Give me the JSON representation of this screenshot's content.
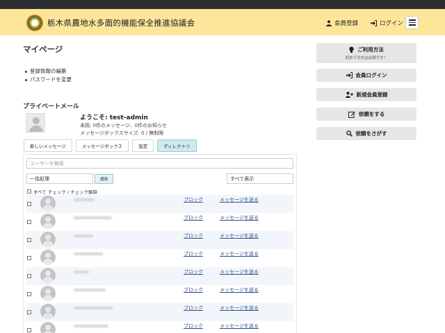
{
  "header": {
    "site_title": "栃木県農地水多面的機能保全推進協議会",
    "register": "会員登録",
    "login": "ログイン"
  },
  "page": {
    "title": "マイページ",
    "links": [
      "登録情報の編集",
      "パスワードを変更"
    ]
  },
  "pm": {
    "title": "プライベートメール",
    "welcome": "ようこそ: test-admin",
    "unread": "未読: 0件のメッセージ、0件のお知らせ",
    "box_size": "メッセージボックスサイズ: 0 / 無制限",
    "tabs": [
      "新しいメッセージ",
      "メッセージボックス",
      "設定",
      "ディレクトリ"
    ],
    "active_tab": "ディレクトリ",
    "search_placeholder": "ユーザーを検索",
    "bulk_action": "一括処理",
    "apply": "適用",
    "filter": "すべて表示",
    "check_all": "すべて チェック / チェック解除",
    "block_label": "ブロック",
    "send_label": "メッセージを送る",
    "row_count": 8
  },
  "sidebar": {
    "guide": "ご利用方法",
    "guide_sub": "初めての方は必読です！",
    "member_login": "会員ログイン",
    "new_member": "新規会員登録",
    "request": "依頼をする",
    "find_request": "依頼をさがす"
  },
  "colors": {
    "header_bg": "#fde69a",
    "top_strip": "#2b2f33",
    "link": "#2c4f8c",
    "active_tab": "#cfe9f1"
  }
}
